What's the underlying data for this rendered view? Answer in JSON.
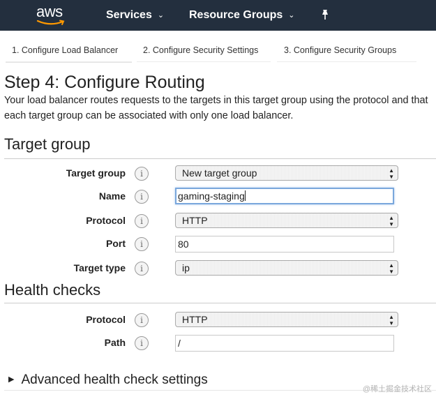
{
  "topnav": {
    "logo_text": "aws",
    "services_label": "Services",
    "resource_groups_label": "Resource Groups",
    "caret": "⌄",
    "pin_icon": "pin-icon",
    "background": "#232f3e",
    "logo_smile_color": "#ff9900"
  },
  "wizard": {
    "tabs": [
      {
        "label": "1. Configure Load Balancer"
      },
      {
        "label": "2. Configure Security Settings"
      },
      {
        "label": "3. Configure Security Groups"
      }
    ]
  },
  "page": {
    "title": "Step 4: Configure Routing",
    "description": "Your load balancer routes requests to the targets in this target group using the protocol and that each target group can be associated with only one load balancer."
  },
  "target_group": {
    "section_title": "Target group",
    "info_icon": "i",
    "target_group_label": "Target group",
    "target_group_value": "New target group",
    "name_label": "Name",
    "name_value": "gaming-staging",
    "protocol_label": "Protocol",
    "protocol_value": "HTTP",
    "port_label": "Port",
    "port_value": "80",
    "target_type_label": "Target type",
    "target_type_value": "ip"
  },
  "health_checks": {
    "section_title": "Health checks",
    "protocol_label": "Protocol",
    "protocol_value": "HTTP",
    "path_label": "Path",
    "path_value": "/"
  },
  "advanced": {
    "label": "Advanced health check settings",
    "triangle": "▶"
  },
  "watermark": "@稀土掘金技术社区"
}
